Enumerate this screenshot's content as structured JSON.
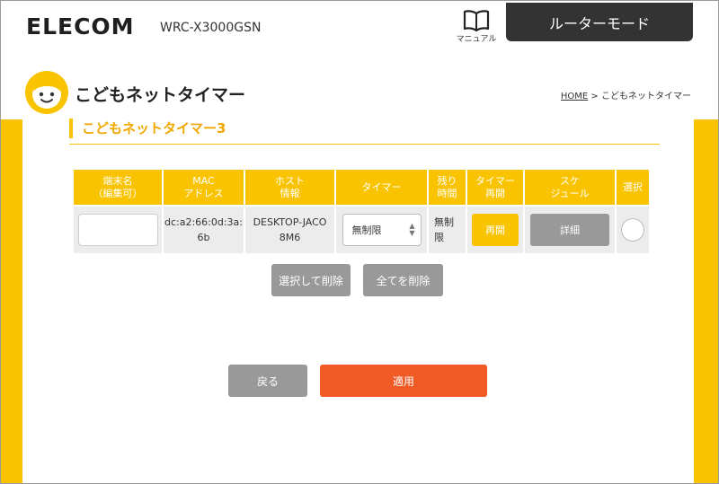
{
  "header": {
    "logo": "ELECOM",
    "model": "WRC-X3000GSN",
    "manual_label": "マニュアル",
    "mode_label": "ルーターモード"
  },
  "page": {
    "title": "こどもネットタイマー",
    "breadcrumb_home": "HOME",
    "breadcrumb_sep": " > ",
    "breadcrumb_current": "こどもネットタイマー"
  },
  "section": {
    "title": "こどもネットタイマー3"
  },
  "table": {
    "headers": {
      "name": [
        "端末名",
        "（編集可）"
      ],
      "mac": [
        "MAC",
        "アドレス"
      ],
      "host": [
        "ホスト",
        "情報"
      ],
      "timer": [
        "タイマー"
      ],
      "remain": [
        "残り",
        "時間"
      ],
      "resume": [
        "タイマー",
        "再開"
      ],
      "schedule": [
        "スケ",
        "ジュール"
      ],
      "select": [
        "選択"
      ]
    },
    "row": {
      "name_value": "",
      "mac": [
        "dc:a2:66:0d:3a:",
        "6b"
      ],
      "host": [
        "DESKTOP-JACO",
        "8M6"
      ],
      "timer_value": "無制限",
      "remain": [
        "無制",
        "限"
      ],
      "resume_label": "再開",
      "detail_label": "詳細"
    }
  },
  "actions": {
    "delete_selected": "選択して削除",
    "delete_all": "全てを削除",
    "back": "戻る",
    "apply": "適用"
  },
  "colors": {
    "accent_yellow": "#f9c300",
    "apply_orange": "#f05a24",
    "gray_button": "#999999",
    "mode_dark": "#333333"
  }
}
